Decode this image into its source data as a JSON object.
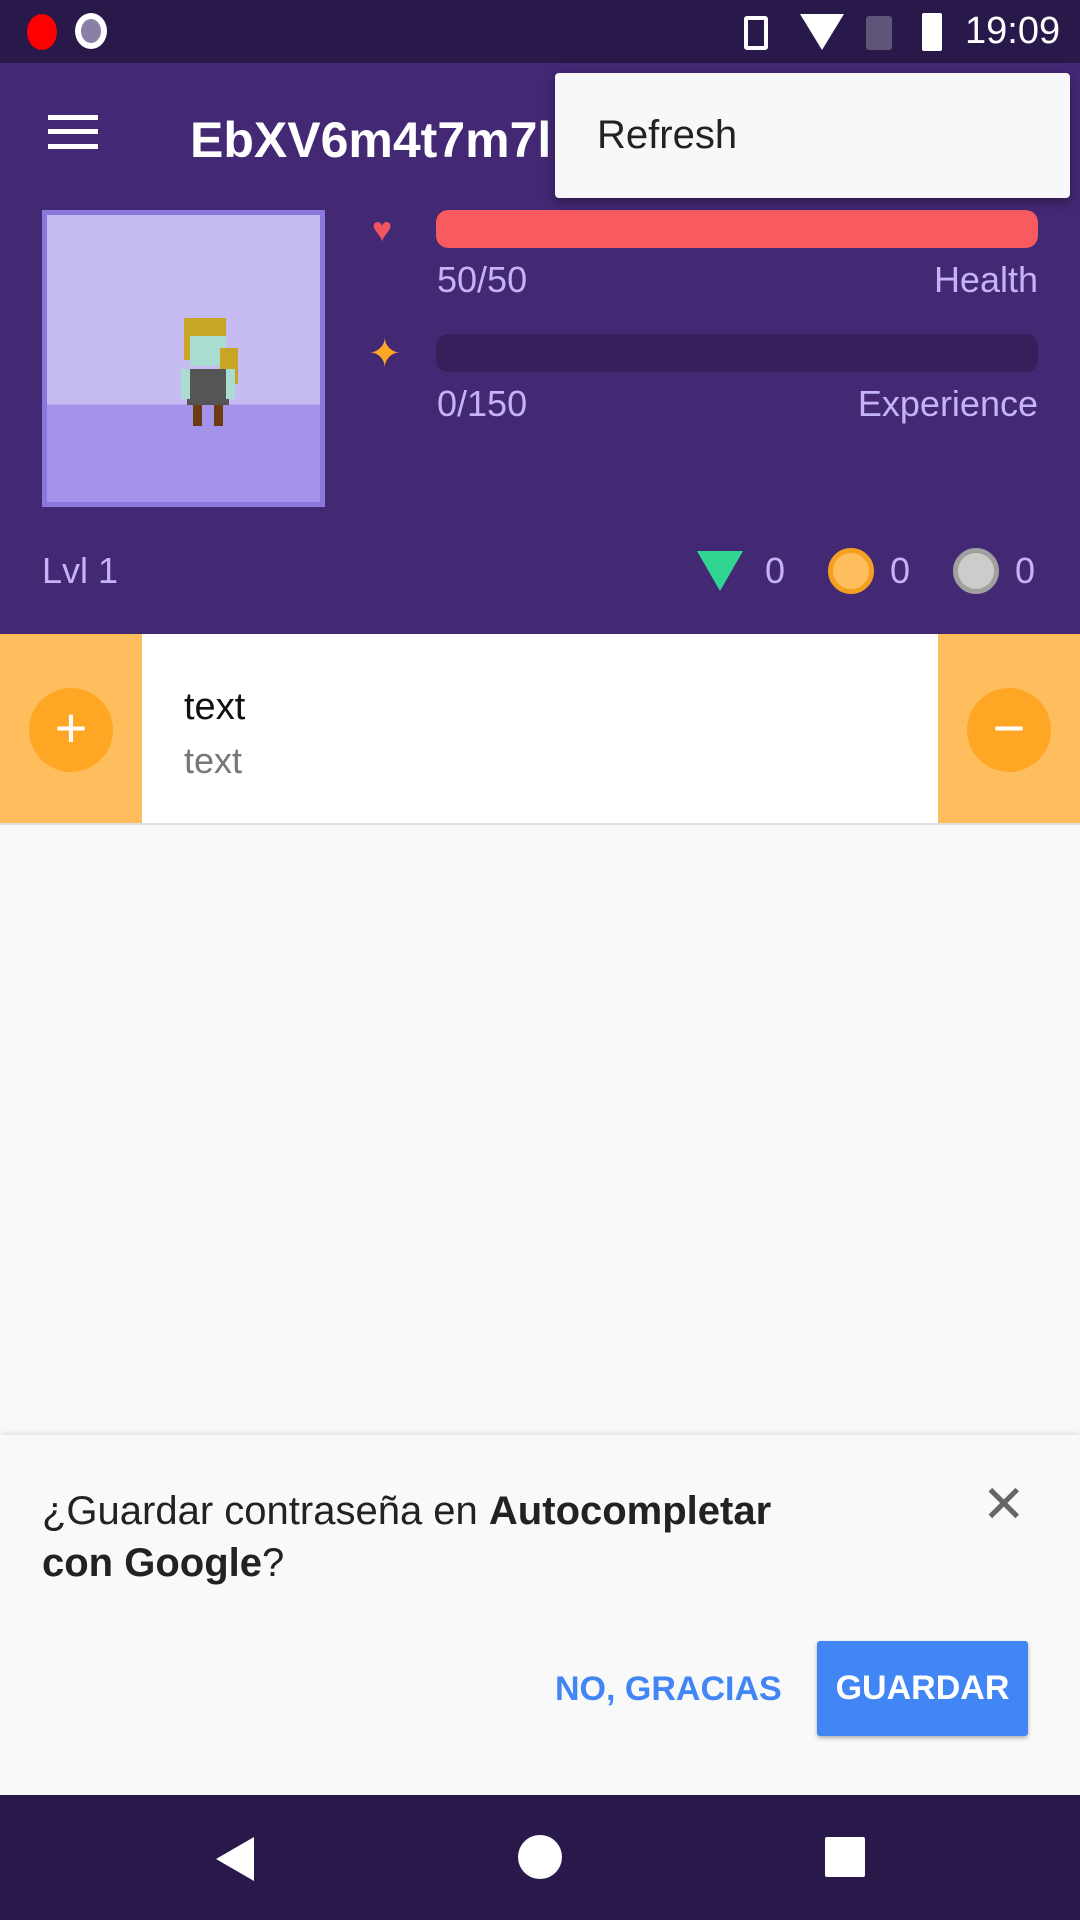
{
  "status_bar": {
    "time": "19:09"
  },
  "toolbar": {
    "title": "EbXV6m4t7m7l"
  },
  "menu": {
    "items": [
      {
        "label": "Refresh"
      }
    ]
  },
  "stats": {
    "health": {
      "value": "50/50",
      "label": "Health",
      "fraction": 1.0
    },
    "experience": {
      "value": "0/150",
      "label": "Experience",
      "fraction": 0.0
    },
    "level": "Lvl 1",
    "gems": "0",
    "gold": "0",
    "hourglasses": "0"
  },
  "task": {
    "title": "text",
    "notes": "text",
    "plus": "+",
    "minus": "−"
  },
  "autofill": {
    "prompt_pre": "¿Guardar contraseña en ",
    "prompt_bold1": "Autocompletar",
    "prompt_bold2": "con Google",
    "prompt_post": "?",
    "no_label": "NO, GRACIAS",
    "save_label": "GUARDAR"
  },
  "colors": {
    "purple": "#432874",
    "health": "#f75b60",
    "orange": "#ffa624",
    "blue": "#4285f4"
  }
}
